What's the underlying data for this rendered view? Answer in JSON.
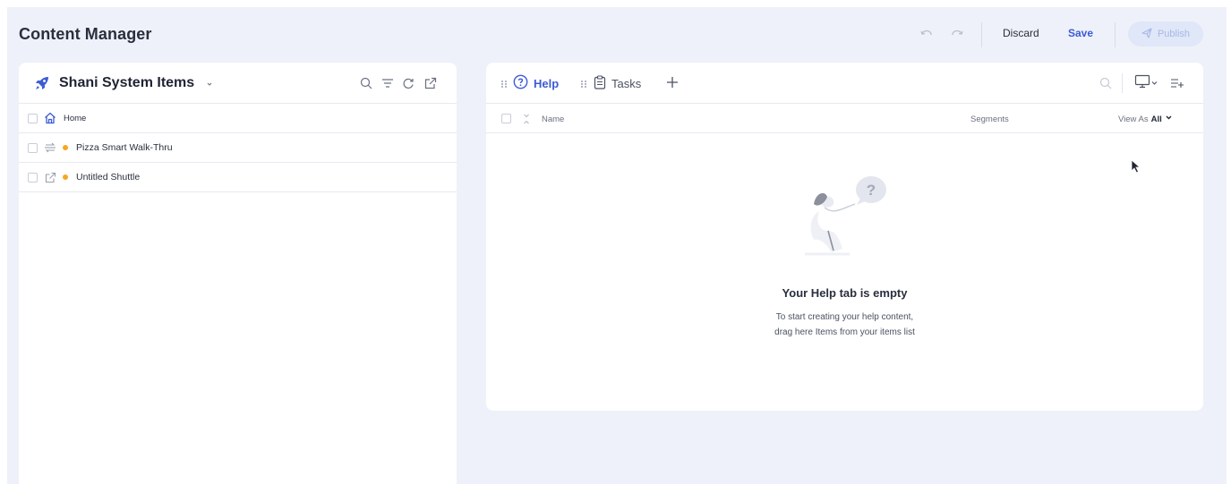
{
  "header": {
    "title": "Content Manager",
    "undo_icon": "undo-icon",
    "redo_icon": "redo-icon",
    "discard_label": "Discard",
    "save_label": "Save",
    "publish_label": "Publish",
    "publish_icon": "send-icon"
  },
  "left_panel": {
    "title": "Shani System Items",
    "title_icon": "rocket-icon",
    "tools": [
      "search-icon",
      "filter-icon",
      "refresh-icon",
      "external-link-icon"
    ],
    "rows": [
      {
        "label": "Home",
        "icon": "home-icon",
        "has_status": false
      },
      {
        "label": "Pizza Smart Walk-Thru",
        "icon": "walkthru-icon",
        "has_status": true
      },
      {
        "label": "Untitled Shuttle",
        "icon": "shuttle-icon",
        "has_status": true
      }
    ],
    "status_color": "#f6a623"
  },
  "right_panel": {
    "tabs": [
      {
        "label": "Help",
        "icon": "help-circle-icon",
        "active": true
      },
      {
        "label": "Tasks",
        "icon": "clipboard-icon",
        "active": false
      }
    ],
    "columns": {
      "name": "Name",
      "segments": "Segments",
      "view_as_label": "View As",
      "view_as_value": "All"
    },
    "empty_state": {
      "title": "Your Help tab is empty",
      "line1": "To start creating your help content,",
      "line2": "drag here Items from your items list"
    }
  },
  "colors": {
    "accent": "#3c5bd4",
    "background": "#eef1f9",
    "publish_bg": "#dfe7f8"
  }
}
